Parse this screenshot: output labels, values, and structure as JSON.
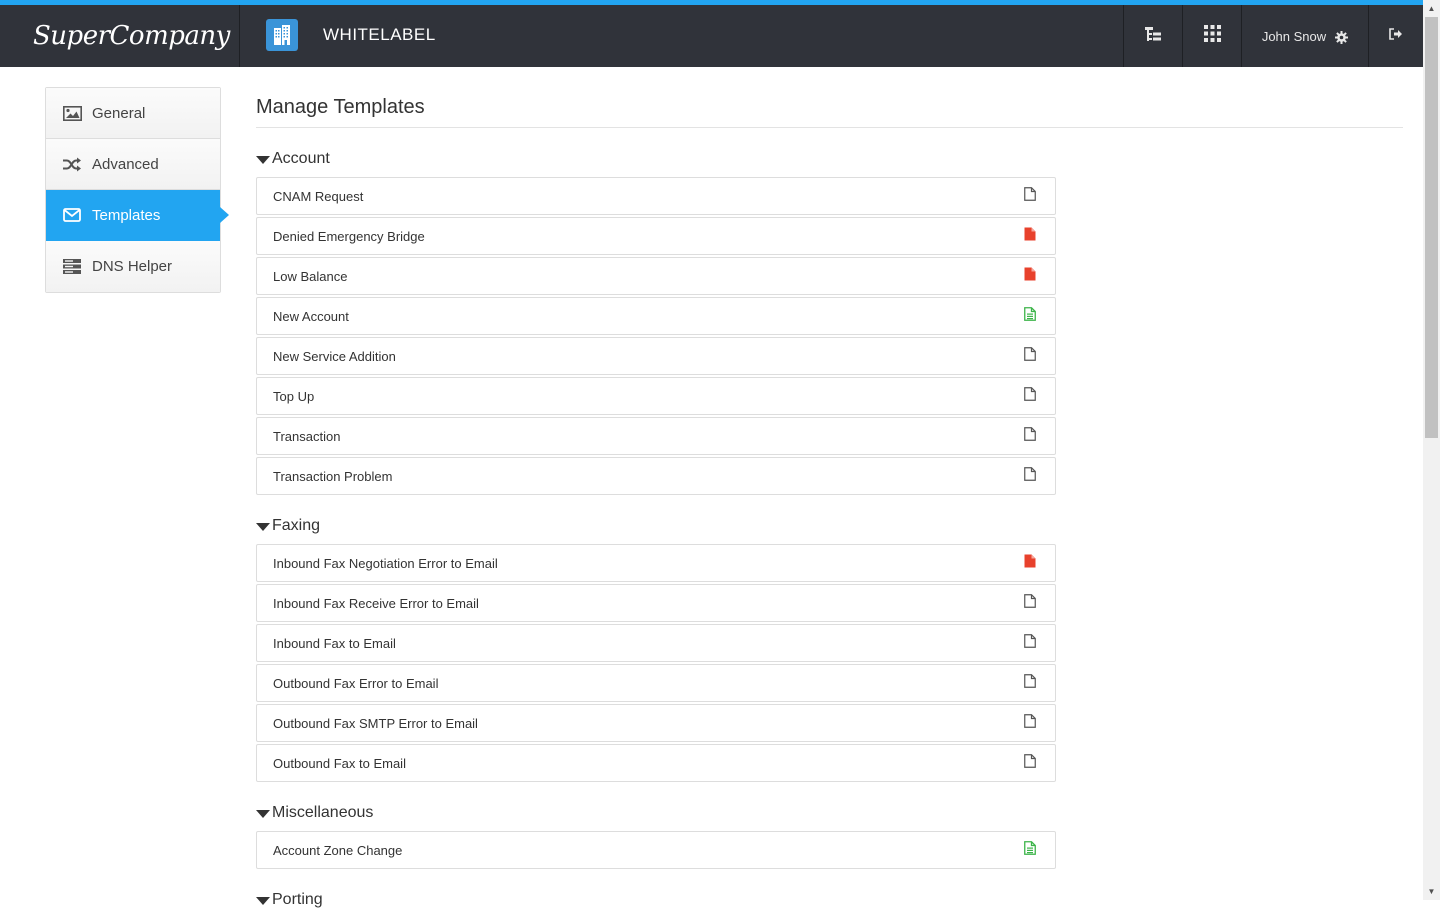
{
  "topbar": {
    "logo": "SuperCompany",
    "app_title": "WHITELABEL",
    "user_name": "John Snow",
    "icons": [
      "app-building-icon",
      "tree-icon",
      "apps-grid-icon",
      "gear-icon",
      "logout-icon"
    ]
  },
  "sidebar": {
    "items": [
      {
        "label": "General",
        "icon": "image-icon"
      },
      {
        "label": "Advanced",
        "icon": "shuffle-icon"
      },
      {
        "label": "Templates",
        "icon": "envelope-icon",
        "active": true
      },
      {
        "label": "DNS Helper",
        "icon": "server-icon"
      }
    ]
  },
  "main": {
    "title": "Manage Templates",
    "sections": [
      {
        "name": "Account",
        "items": [
          {
            "label": "CNAM Request",
            "status": "default"
          },
          {
            "label": "Denied Emergency Bridge",
            "status": "disabled"
          },
          {
            "label": "Low Balance",
            "status": "disabled"
          },
          {
            "label": "New Account",
            "status": "custom"
          },
          {
            "label": "New Service Addition",
            "status": "default"
          },
          {
            "label": "Top Up",
            "status": "default"
          },
          {
            "label": "Transaction",
            "status": "default"
          },
          {
            "label": "Transaction Problem",
            "status": "default"
          }
        ]
      },
      {
        "name": "Faxing",
        "items": [
          {
            "label": "Inbound Fax Negotiation Error to Email",
            "status": "disabled"
          },
          {
            "label": "Inbound Fax Receive Error to Email",
            "status": "default"
          },
          {
            "label": "Inbound Fax to Email",
            "status": "default"
          },
          {
            "label": "Outbound Fax Error to Email",
            "status": "default"
          },
          {
            "label": "Outbound Fax SMTP Error to Email",
            "status": "default"
          },
          {
            "label": "Outbound Fax to Email",
            "status": "default"
          }
        ]
      },
      {
        "name": "Miscellaneous",
        "items": [
          {
            "label": "Account Zone Change",
            "status": "custom"
          }
        ]
      },
      {
        "name": "Porting",
        "items": []
      }
    ]
  },
  "colors": {
    "accent": "#22a5f1",
    "topbar": "#30333a",
    "status_disabled": "#e8412c",
    "status_custom": "#3cb449",
    "status_default": "#555555"
  }
}
